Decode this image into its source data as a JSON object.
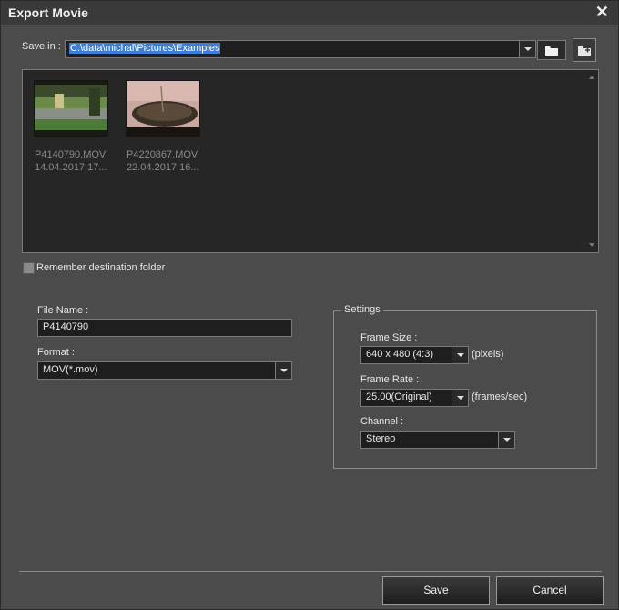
{
  "window": {
    "title": "Export Movie"
  },
  "save_in": {
    "label": "Save in :",
    "path": "C:\\data\\michal\\Pictures\\Examples"
  },
  "files": [
    {
      "name": "P4140790.MOV",
      "date": "14.04.2017 17..."
    },
    {
      "name": "P4220867.MOV",
      "date": "22.04.2017 16..."
    }
  ],
  "remember_label": "Remember destination folder",
  "file_name": {
    "label": "File Name :",
    "value": "P4140790"
  },
  "format": {
    "label": "Format :",
    "value": "MOV(*.mov)"
  },
  "settings": {
    "title": "Settings",
    "frame_size": {
      "label": "Frame Size :",
      "value": "640 x 480 (4:3)",
      "unit": "(pixels)"
    },
    "frame_rate": {
      "label": "Frame Rate :",
      "value": "25.00(Original)",
      "unit": "(frames/sec)"
    },
    "channel": {
      "label": "Channel :",
      "value": "Stereo"
    }
  },
  "buttons": {
    "save": "Save",
    "cancel": "Cancel"
  },
  "colors": {
    "selection": "#3d7fd8",
    "background": "#4b4b4b",
    "field": "#1e1e1e"
  }
}
